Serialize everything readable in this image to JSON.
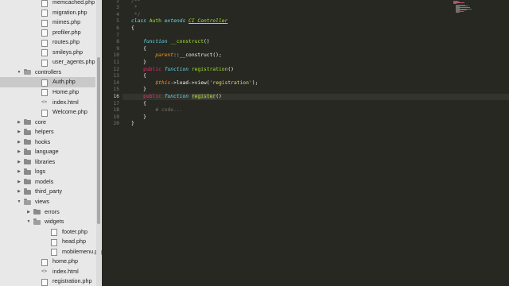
{
  "sidebar": {
    "items": [
      {
        "label": "memcached.php",
        "type": "file"
      },
      {
        "label": "migration.php",
        "type": "file"
      },
      {
        "label": "mimes.php",
        "type": "file"
      },
      {
        "label": "profiler.php",
        "type": "file"
      },
      {
        "label": "routes.php",
        "type": "file"
      },
      {
        "label": "smileys.php",
        "type": "file"
      },
      {
        "label": "user_agents.php",
        "type": "file"
      },
      {
        "label": "controllers",
        "type": "folder-open"
      },
      {
        "label": "Auth.php",
        "type": "file",
        "selected": true
      },
      {
        "label": "Home.php",
        "type": "file"
      },
      {
        "label": "index.html",
        "type": "html"
      },
      {
        "label": "Welcome.php",
        "type": "file"
      },
      {
        "label": "core",
        "type": "folder"
      },
      {
        "label": "helpers",
        "type": "folder"
      },
      {
        "label": "hooks",
        "type": "folder"
      },
      {
        "label": "language",
        "type": "folder"
      },
      {
        "label": "libraries",
        "type": "folder"
      },
      {
        "label": "logs",
        "type": "folder"
      },
      {
        "label": "models",
        "type": "folder"
      },
      {
        "label": "third_party",
        "type": "folder"
      },
      {
        "label": "views",
        "type": "folder-open"
      },
      {
        "label": "errors",
        "type": "folder"
      },
      {
        "label": "widgets",
        "type": "folder-open"
      },
      {
        "label": "footer.php",
        "type": "file"
      },
      {
        "label": "head.php",
        "type": "file"
      },
      {
        "label": "mobilemenu.php",
        "type": "file"
      },
      {
        "label": "home.php",
        "type": "file"
      },
      {
        "label": "index.html",
        "type": "html"
      },
      {
        "label": "registration.php",
        "type": "file"
      }
    ]
  },
  "editor": {
    "current_line": 16,
    "line_numbers": [
      "2",
      "3",
      "4",
      "5",
      "6",
      "7",
      "8",
      "9",
      "10",
      "11",
      "12",
      "13",
      "14",
      "15",
      "16",
      "17",
      "18",
      "19",
      "20"
    ],
    "code": [
      [
        {
          "t": "/**",
          "c": "comment"
        }
      ],
      [
        {
          "t": " *",
          "c": "comment"
        }
      ],
      [
        {
          "t": " */",
          "c": "comment"
        }
      ],
      [
        {
          "t": "class ",
          "c": "fn"
        },
        {
          "t": "Auth",
          "c": "name"
        },
        {
          "t": " extends ",
          "c": "fn"
        },
        {
          "t": "CI_Controller",
          "c": "inherit"
        }
      ],
      [
        {
          "t": "{",
          "c": "plain"
        }
      ],
      [
        {
          "t": "",
          "c": "plain"
        }
      ],
      [
        {
          "t": "    ",
          "c": "plain"
        },
        {
          "t": "function",
          "c": "fn"
        },
        {
          "t": " ",
          "c": "plain"
        },
        {
          "t": "__construct",
          "c": "name"
        },
        {
          "t": "()",
          "c": "plain"
        }
      ],
      [
        {
          "t": "    {",
          "c": "plain"
        }
      ],
      [
        {
          "t": "        ",
          "c": "plain"
        },
        {
          "t": "parent",
          "c": "var"
        },
        {
          "t": "::__construct();",
          "c": "plain"
        }
      ],
      [
        {
          "t": "    }",
          "c": "plain"
        }
      ],
      [
        {
          "t": "    ",
          "c": "plain"
        },
        {
          "t": "public",
          "c": "kw"
        },
        {
          "t": " ",
          "c": "plain"
        },
        {
          "t": "function",
          "c": "fn"
        },
        {
          "t": " ",
          "c": "plain"
        },
        {
          "t": "registration",
          "c": "name"
        },
        {
          "t": "()",
          "c": "plain"
        }
      ],
      [
        {
          "t": "    {",
          "c": "plain"
        }
      ],
      [
        {
          "t": "        ",
          "c": "plain"
        },
        {
          "t": "$this",
          "c": "var"
        },
        {
          "t": "->load->view(",
          "c": "plain"
        },
        {
          "t": "'registration'",
          "c": "str"
        },
        {
          "t": ");",
          "c": "plain"
        }
      ],
      [
        {
          "t": "    }",
          "c": "plain"
        }
      ],
      [
        {
          "t": "    ",
          "c": "plain"
        },
        {
          "t": "public",
          "c": "kw"
        },
        {
          "t": " ",
          "c": "plain"
        },
        {
          "t": "function",
          "c": "fn"
        },
        {
          "t": " ",
          "c": "plain"
        },
        {
          "t": "register",
          "c": "hlword"
        },
        {
          "t": "()",
          "c": "plain"
        }
      ],
      [
        {
          "t": "    {",
          "c": "plain"
        }
      ],
      [
        {
          "t": "        # code...",
          "c": "comment"
        }
      ],
      [
        {
          "t": "    }",
          "c": "plain"
        }
      ],
      [
        {
          "t": "}",
          "c": "plain"
        }
      ]
    ]
  },
  "colors": {
    "editor_bg": "#272822",
    "sidebar_bg": "#e8e8e8",
    "keyword": "#f92672",
    "function_kw": "#66d9ef",
    "name": "#a6e22e",
    "string": "#e6db74",
    "variable": "#fd971f",
    "comment": "#75715e"
  }
}
